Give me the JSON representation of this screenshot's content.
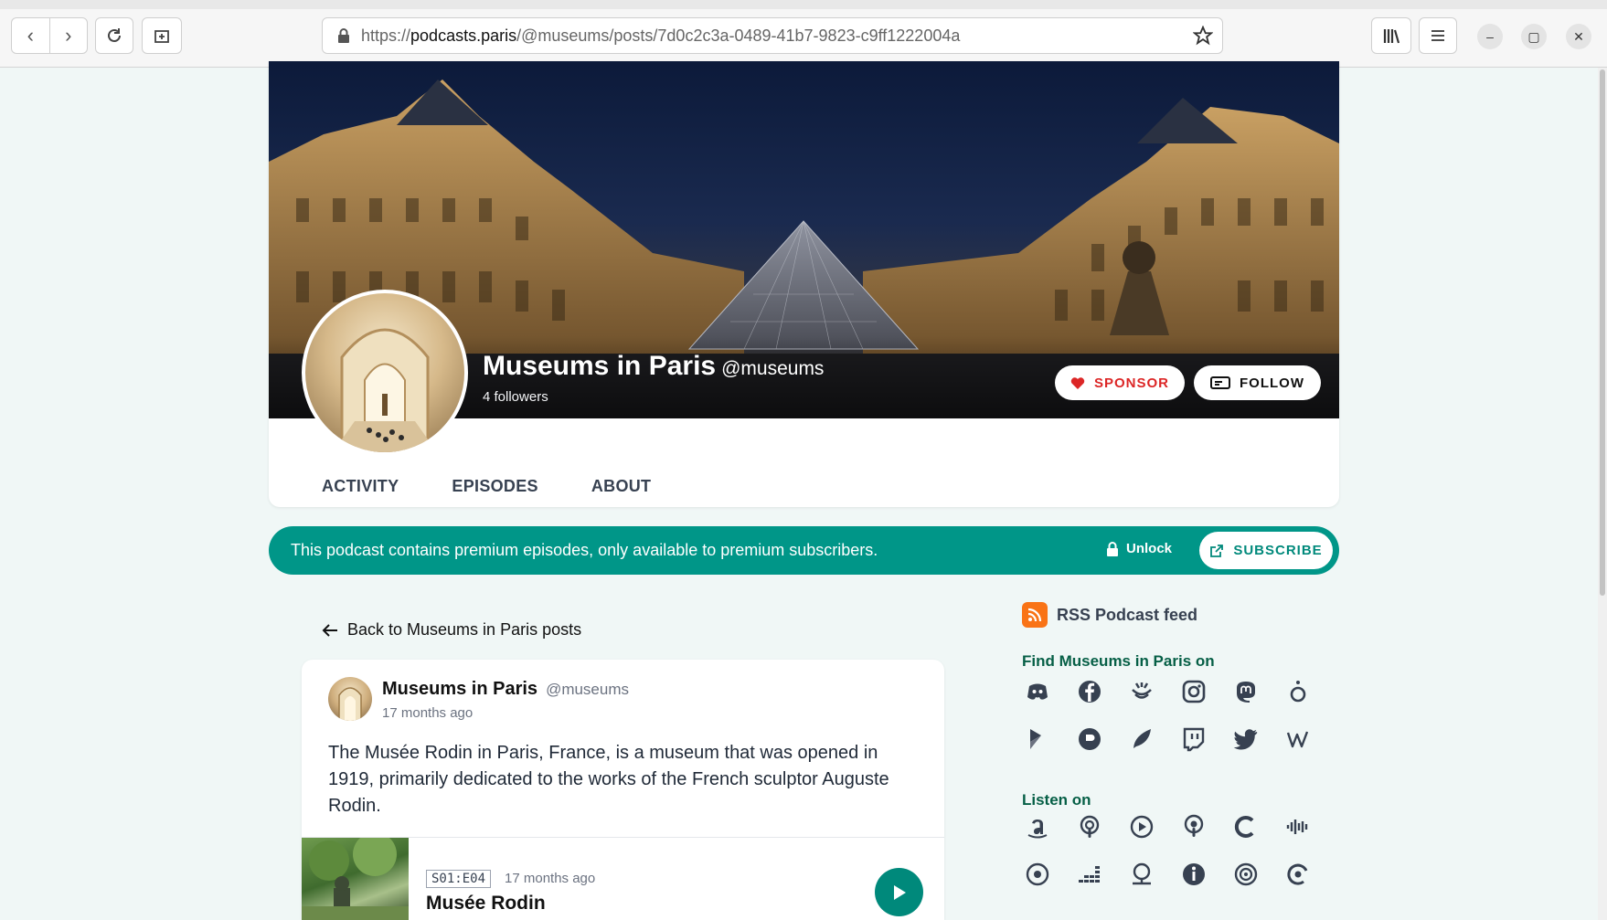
{
  "browser": {
    "url_scheme": "https://",
    "url_host": "podcasts.paris",
    "url_path": "/@museums/posts/7d0c2c3a-0489-41b7-9823-c9ff1222004a"
  },
  "podcast": {
    "name": "Museums in Paris",
    "handle": "@museums",
    "followers": "4 followers",
    "sponsor_label": "SPONSOR",
    "follow_label": "FOLLOW"
  },
  "tabs": [
    {
      "label": "ACTIVITY"
    },
    {
      "label": "EPISODES"
    },
    {
      "label": "ABOUT"
    }
  ],
  "premium": {
    "text": "This podcast contains premium episodes, only available to premium subscribers.",
    "unlock_label": "Unlock",
    "subscribe_label": "SUBSCRIBE"
  },
  "back_link": "Back to Museums in Paris posts",
  "post": {
    "author": "Museums in Paris",
    "handle": "@museums",
    "time": "17 months ago",
    "body": "The Musée Rodin in Paris, France, is a museum that was opened in 1919, primarily dedicated to the works of the French sculptor Auguste Rodin.",
    "episode": {
      "number": "S01:E04",
      "time": "17 months ago",
      "title": "Musée Rodin"
    }
  },
  "sidebar": {
    "rss_label": "RSS Podcast feed",
    "find_on_title": "Find Museums in Paris on",
    "listen_on_title": "Listen on",
    "social_icons": [
      "discord-icon",
      "facebook-icon",
      "funkwhale-icon",
      "instagram-icon",
      "mastodon-icon",
      "pixelfed-icon",
      "peertube-icon",
      "podcastindex-icon",
      "misskey-icon",
      "twitch-icon",
      "twitter-icon",
      "writefreely-icon"
    ],
    "listen_icons": [
      "amazon-icon",
      "apple-podcasts-icon",
      "castbox-icon",
      "castopod-icon",
      "castro-icon",
      "audible-icon",
      "overcast-icon",
      "deezer-icon",
      "podcast-addict-icon",
      "podchaser-icon",
      "podnews-icon",
      "podcast-republic-icon"
    ]
  }
}
